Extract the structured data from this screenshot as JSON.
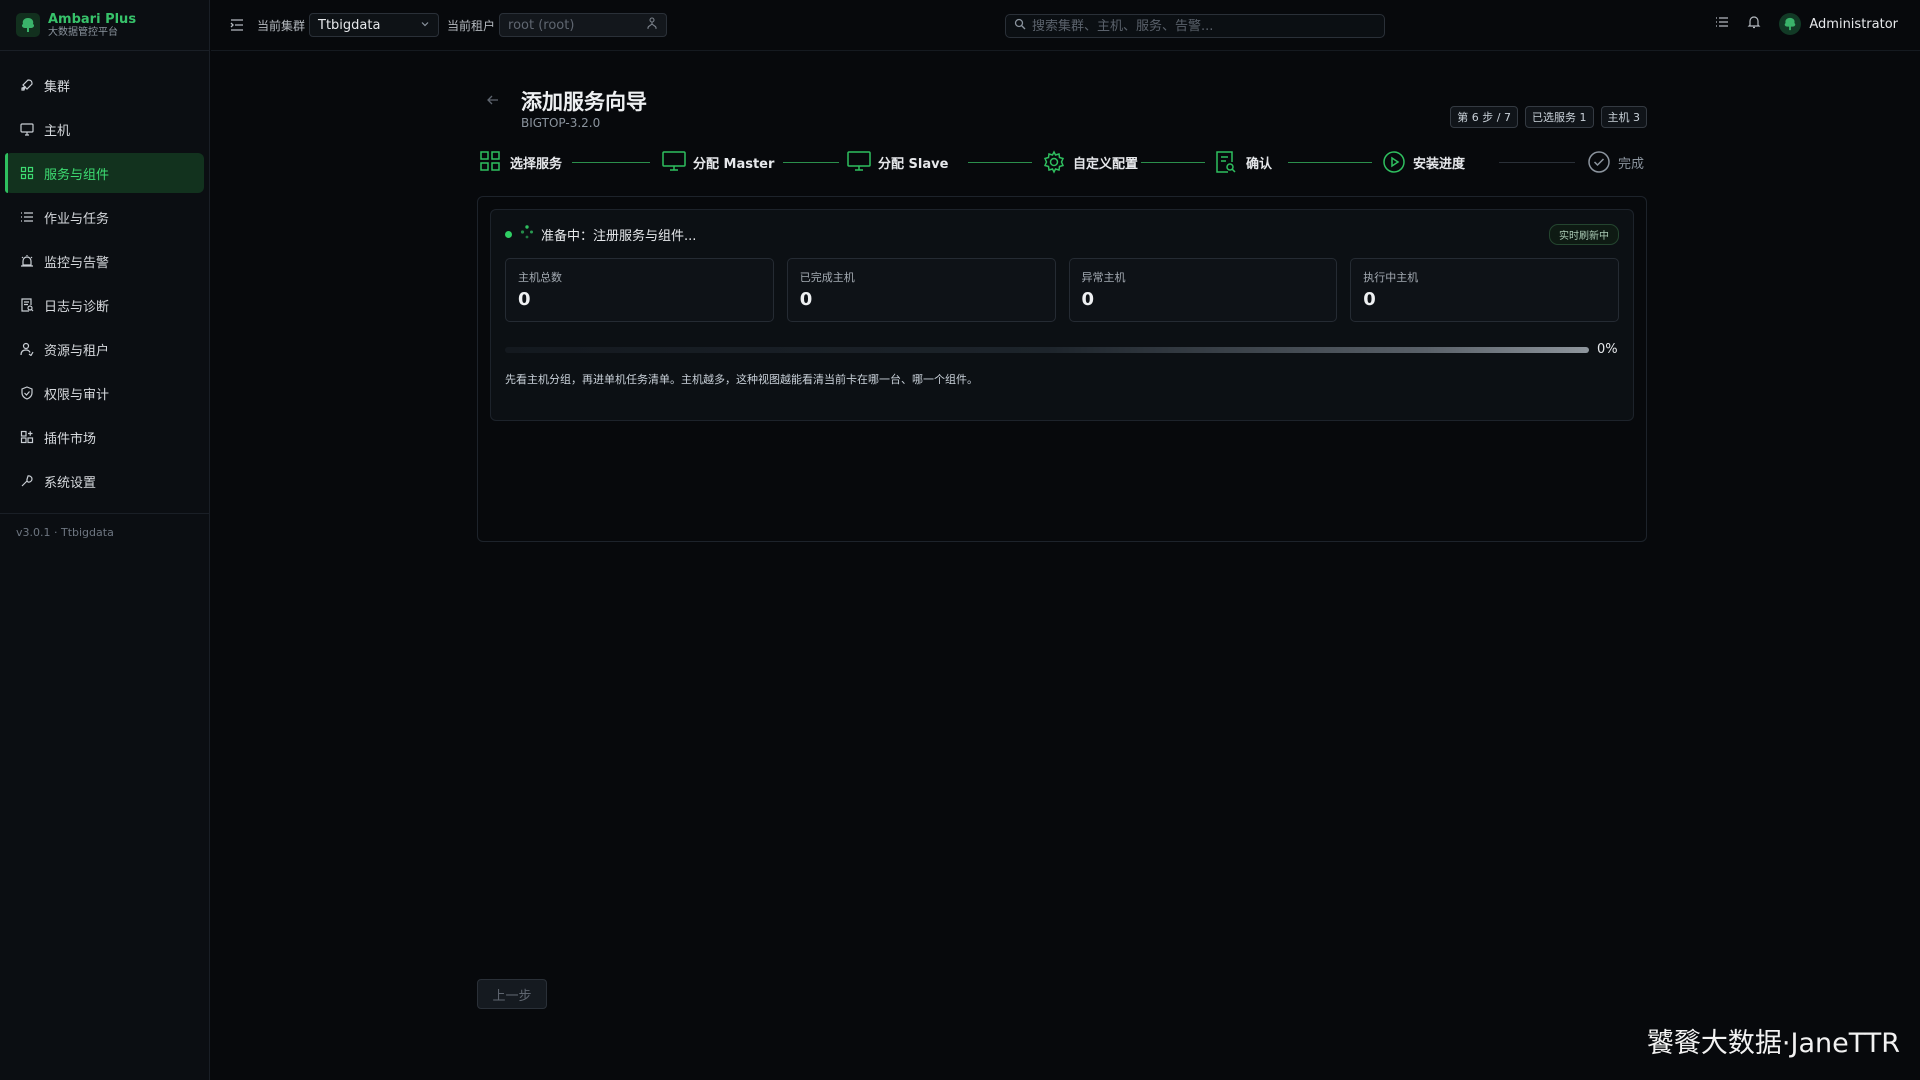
{
  "brand": {
    "title": "Ambari Plus",
    "subtitle": "大数据管控平台"
  },
  "sidebar": {
    "items": [
      {
        "label": "集群",
        "icon": "rocket-icon"
      },
      {
        "label": "主机",
        "icon": "monitor-icon"
      },
      {
        "label": "服务与组件",
        "icon": "grid-icon",
        "active": true
      },
      {
        "label": "作业与任务",
        "icon": "list-icon"
      },
      {
        "label": "监控与告警",
        "icon": "alarm-icon"
      },
      {
        "label": "日志与诊断",
        "icon": "file-search-icon"
      },
      {
        "label": "资源与租户",
        "icon": "users-icon"
      },
      {
        "label": "权限与审计",
        "icon": "shield-icon"
      },
      {
        "label": "插件市场",
        "icon": "apps-icon"
      },
      {
        "label": "系统设置",
        "icon": "tool-icon"
      }
    ],
    "version": "v3.0.1 · Ttbigdata"
  },
  "topbar": {
    "cluster_label": "当前集群",
    "cluster_value": "Ttbigdata",
    "tenant_label": "当前租户",
    "tenant_placeholder": "root (root)",
    "search_placeholder": "搜索集群、主机、服务、告警...",
    "user_name": "Administrator"
  },
  "page": {
    "title": "添加服务向导",
    "subtitle": "BIGTOP-3.2.0",
    "badges": [
      "第 6 步 / 7",
      "已选服务 1",
      "主机 3"
    ]
  },
  "steps": [
    {
      "label": "选择服务",
      "icon": "grid-icon",
      "state": "done"
    },
    {
      "label": "分配 Master",
      "icon": "monitor-icon",
      "state": "done"
    },
    {
      "label": "分配 Slave",
      "icon": "monitor-icon",
      "state": "done"
    },
    {
      "label": "自定义配置",
      "icon": "gear-icon",
      "state": "done"
    },
    {
      "label": "确认",
      "icon": "file-search-icon",
      "state": "done"
    },
    {
      "label": "安装进度",
      "icon": "play-circle-icon",
      "state": "current"
    },
    {
      "label": "完成",
      "icon": "check-circle-icon",
      "state": "pending"
    }
  ],
  "status": {
    "text": "准备中：注册服务与组件...",
    "live_badge": "实时刷新中",
    "color": "#2fcf64"
  },
  "stats": [
    {
      "label": "主机总数",
      "value": "0"
    },
    {
      "label": "已完成主机",
      "value": "0"
    },
    {
      "label": "异常主机",
      "value": "0"
    },
    {
      "label": "执行中主机",
      "value": "0"
    }
  ],
  "progress": {
    "percent": 0,
    "percent_text": "0%"
  },
  "hint": "先看主机分组，再进单机任务清单。主机越多，这种视图越能看清当前卡在哪一台、哪一个组件。",
  "buttons": {
    "prev": "上一步"
  },
  "watermark": "饕餮大数据·JaneTTR",
  "colors": {
    "accent": "#2fbf5f",
    "background": "#07090c"
  }
}
